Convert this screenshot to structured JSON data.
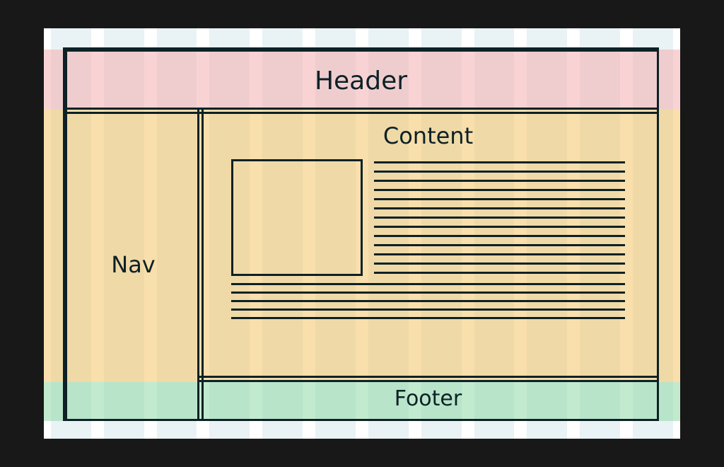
{
  "regions": {
    "header": "Header",
    "nav": "Nav",
    "content": "Content",
    "footer": "Footer"
  },
  "grid": {
    "columns": 12
  },
  "colors": {
    "header_band": "#f4aeb1",
    "middle_band": "#f4c567",
    "footer_band": "#8fd8a7",
    "column_stripe": "#cfe3e6",
    "outline": "#0d2126"
  }
}
